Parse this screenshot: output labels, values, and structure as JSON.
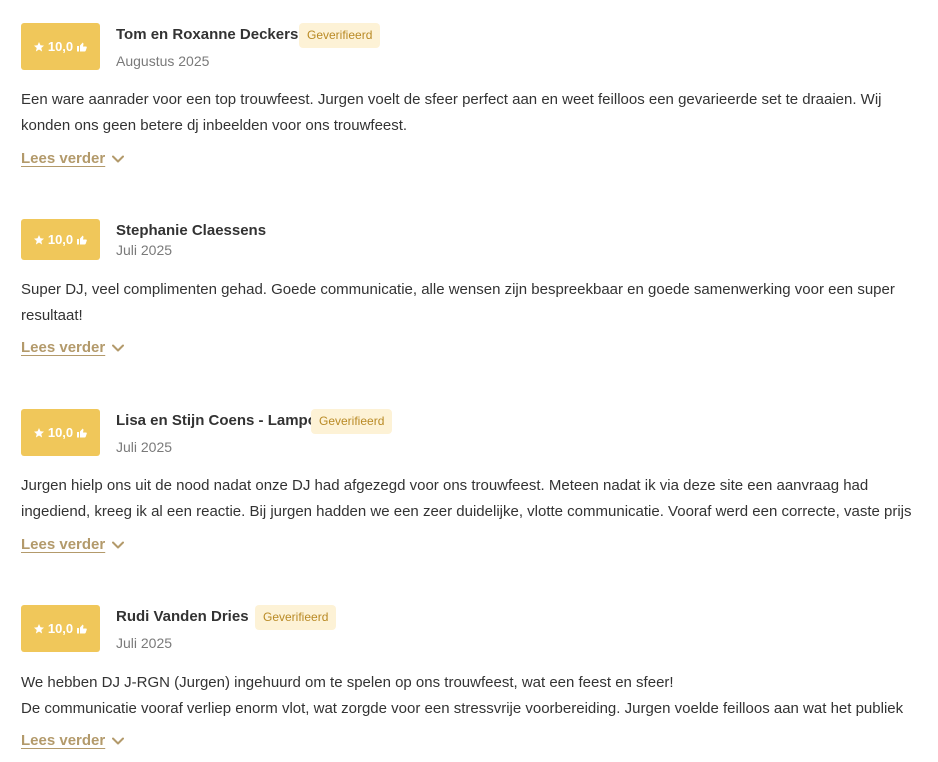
{
  "reviews": [
    {
      "score": "10,0",
      "name": "Tom en Roxanne Deckers",
      "verified": "Geverifieerd",
      "date": "Augustus 2025",
      "text": [
        "Een ware aanrader voor een top trouwfeest. Jurgen voelt de sfeer perfect aan en weet feilloos een gevarieerde set te draaien. Wij konden ons geen betere dj inbeelden voor ons trouwfeest."
      ],
      "read_more": "Lees verder"
    },
    {
      "score": "10,0",
      "name": "Stephanie Claessens",
      "verified": "",
      "date": "Juli 2025",
      "text": [
        "Super DJ, veel complimenten gehad. Goede communicatie, alle wensen zijn bespreekbaar en goede samenwerking voor een super resultaat!"
      ],
      "read_more": "Lees verder"
    },
    {
      "score": "10,0",
      "name": "Lisa en Stijn Coens - Lampo",
      "verified": "Geverifieerd",
      "date": "Juli 2025",
      "text": [
        "Jurgen hielp ons uit de nood nadat onze DJ had afgezegd voor ons trouwfeest. Meteen nadat ik via deze site een aanvraag had ingediend, kreeg ik al een reactie. Bij jurgen hadden we een zeer duidelijke, vlotte communicatie. Vooraf werd een correcte, vaste prijs afgesproken"
      ],
      "read_more": "Lees verder"
    },
    {
      "score": "10,0",
      "name": "Rudi Vanden Dries",
      "verified": "Geverifieerd",
      "date": "Juli 2025",
      "text": [
        "We hebben DJ J-RGN (Jurgen) ingehuurd om te spelen op ons trouwfeest, wat een feest en sfeer!",
        "De communicatie vooraf verliep enorm vlot, wat zorgde voor een stressvrije voorbereiding. Jurgen voelde feilloos aan wat het publiek"
      ],
      "read_more": "Lees verder"
    }
  ],
  "icons": {
    "star": "star-icon",
    "thumb": "thumbs-up-icon",
    "chevron": "chevron-down-icon"
  },
  "colors": {
    "score_badge": "#f0c75a",
    "verified_bg": "#fdf2d6",
    "verified_text": "#b98a25",
    "link": "#b39a6b"
  }
}
